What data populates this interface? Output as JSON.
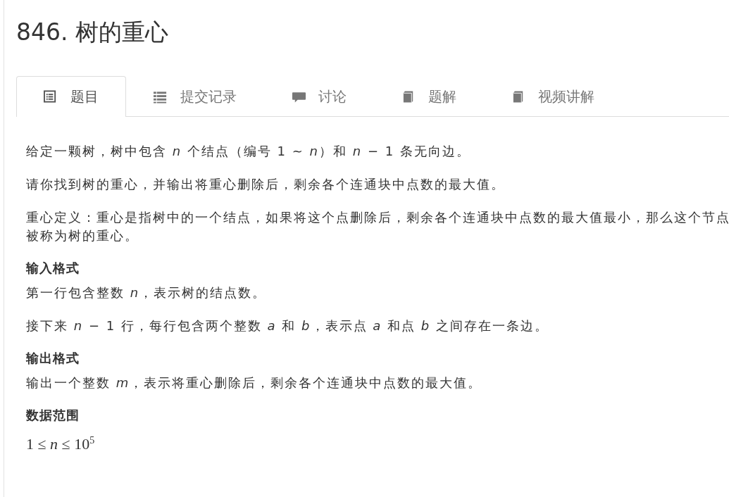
{
  "title": "846. 树的重心",
  "tabs": [
    {
      "label": "题目",
      "selected": true,
      "kind": "document"
    },
    {
      "label": "提交记录",
      "selected": false,
      "kind": "list"
    },
    {
      "label": "讨论",
      "selected": false,
      "kind": "comment"
    },
    {
      "label": "题解",
      "selected": false,
      "kind": "book"
    },
    {
      "label": "视频讲解",
      "selected": false,
      "kind": "book"
    }
  ],
  "content": [
    {
      "kind": "paragraph",
      "lines": [
        "给定一颗树，树中包含 *n* 个结点（编号 1 ∼ *n*）和 *n* − 1 条无向边。"
      ]
    },
    {
      "kind": "paragraph",
      "lines": [
        "请你找到树的重心，并输出将重心删除后，剩余各个连通块中点数的最大值。"
      ]
    },
    {
      "kind": "paragraph",
      "lines": [
        "重心定义：重心是指树中的一个结点，如果将这个点删除后，剩余各个连通块中点数的最大值最小，那么这个节点",
        "被称为树的重心。"
      ]
    },
    {
      "kind": "heading",
      "text": "输入格式"
    },
    {
      "kind": "paragraph",
      "lines": [
        "第一行包含整数 *n*，表示树的结点数。"
      ]
    },
    {
      "kind": "paragraph",
      "lines": [
        "接下来 *n* − 1 行，每行包含两个整数 *a* 和 *b*，表示点 *a* 和点 *b* 之间存在一条边。"
      ]
    },
    {
      "kind": "heading",
      "text": "输出格式"
    },
    {
      "kind": "paragraph",
      "lines": [
        "输出一个整数 *m*，表示将重心删除后，剩余各个连通块中点数的最大值。"
      ]
    },
    {
      "kind": "heading",
      "text": "数据范围"
    },
    {
      "kind": "math",
      "text": "1 ≤ *n* ≤ 10$^{5}$"
    }
  ]
}
